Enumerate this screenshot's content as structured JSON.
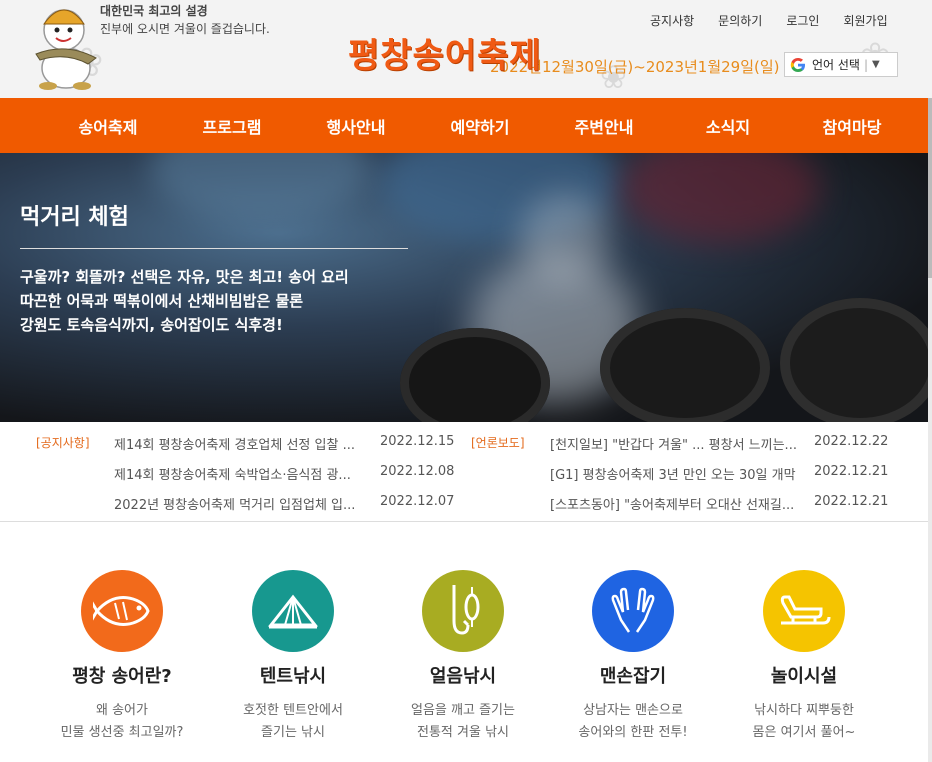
{
  "header": {
    "slogan_line1": "대한민국 최고의 설경",
    "slogan_line2": "진부에 오시면 겨울이 즐겁습니다.",
    "festival_title": "평창송어축제",
    "festival_date": "2022년12월30일(금)~2023년1월29일(일)",
    "util_nav": [
      "공지사항",
      "문의하기",
      "로그인",
      "회원가입"
    ],
    "language_select": "언어 선택"
  },
  "main_nav": [
    "송어축제",
    "프로그램",
    "행사안내",
    "예약하기",
    "주변안내",
    "소식지",
    "참여마당"
  ],
  "hero": {
    "title": "먹거리 체험",
    "desc_line1": "구울까? 회뜰까? 선택은 자유, 맛은 최고! 송어 요리",
    "desc_line2": "따끈한 어묵과 떡볶이에서 산채비빔밥은 물론",
    "desc_line3": "강원도 토속음식까지, 송어잡이도 식후경!"
  },
  "news": {
    "notice_tag": "[공지사항]",
    "press_tag": "[언론보도]",
    "notices": [
      {
        "title": "제14회 평창송어축제 경호업체 선정 입찰 ...",
        "date": "2022.12.15"
      },
      {
        "title": "제14회 평창송어축제 숙박업소·음식점 광...",
        "date": "2022.12.08"
      },
      {
        "title": "2022년 평창송어축제 먹거리 입점업체 입...",
        "date": "2022.12.07"
      }
    ],
    "press": [
      {
        "title": "[천지일보] \"반갑다 겨울\" ... 평창서 느끼는...",
        "date": "2022.12.22"
      },
      {
        "title": "[G1] 평창송어축제 3년 만인 오는 30일 개막",
        "date": "2022.12.21"
      },
      {
        "title": "[스포츠동아] \"송어축제부터 오대산 선재길...",
        "date": "2022.12.21"
      }
    ]
  },
  "quick_menu": [
    {
      "title": "평창 송어란?",
      "desc1": "왜 송어가",
      "desc2": "민물 생선중 최고일까?",
      "color": "#f26a1b",
      "icon": "fish-icon"
    },
    {
      "title": "텐트낚시",
      "desc1": "호젓한 텐트안에서",
      "desc2": "즐기는 낚시",
      "color": "#17988f",
      "icon": "tent-icon"
    },
    {
      "title": "얼음낚시",
      "desc1": "얼음을 깨고 즐기는",
      "desc2": "전통적 겨울 낚시",
      "color": "#a8ac22",
      "icon": "fishing-hook-icon"
    },
    {
      "title": "맨손잡기",
      "desc1": "상남자는 맨손으로",
      "desc2": "송어와의 한판 전투!",
      "color": "#1f64e2",
      "icon": "hands-icon"
    },
    {
      "title": "놀이시설",
      "desc1": "낚시하다 찌뿌둥한",
      "desc2": "몸은 여기서 풀어~",
      "color": "#f5c400",
      "icon": "sled-icon"
    }
  ]
}
